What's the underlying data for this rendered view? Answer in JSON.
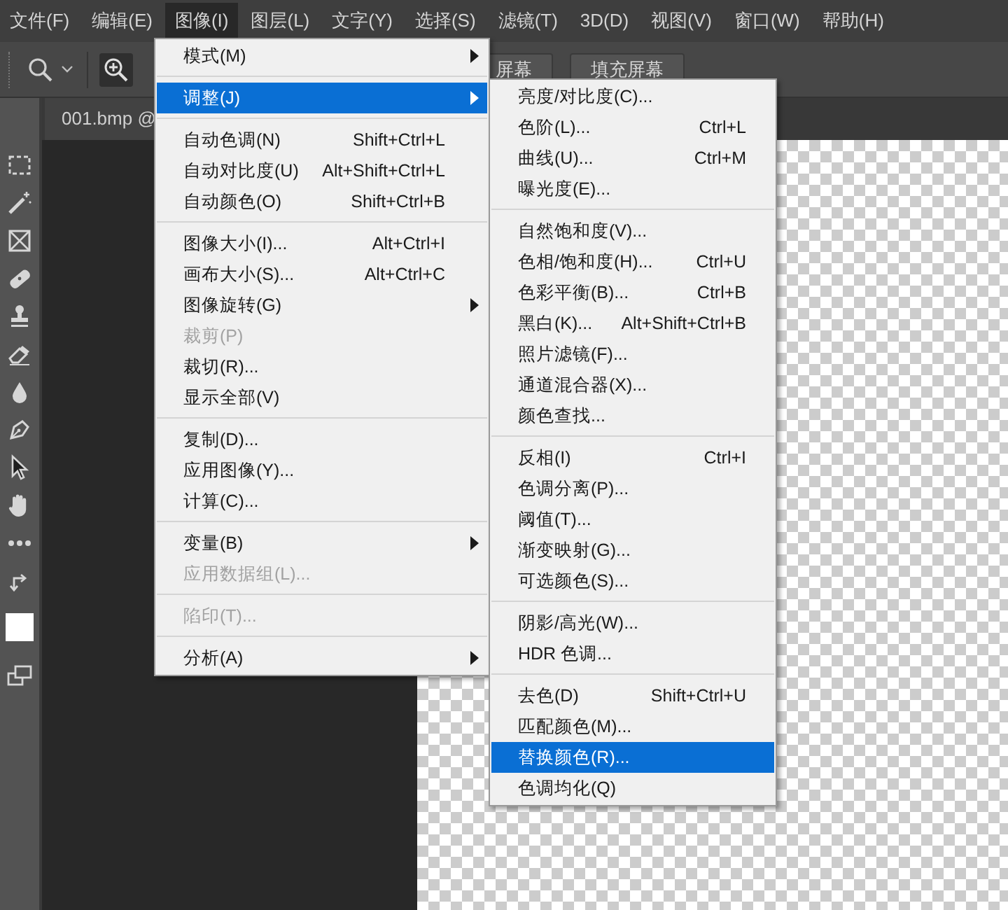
{
  "menu_bar": [
    {
      "label": "文件(F)",
      "selected": false
    },
    {
      "label": "编辑(E)",
      "selected": false
    },
    {
      "label": "图像(I)",
      "selected": true
    },
    {
      "label": "图层(L)",
      "selected": false
    },
    {
      "label": "文字(Y)",
      "selected": false
    },
    {
      "label": "选择(S)",
      "selected": false
    },
    {
      "label": "滤镜(T)",
      "selected": false
    },
    {
      "label": "3D(D)",
      "selected": false
    },
    {
      "label": "视图(V)",
      "selected": false
    },
    {
      "label": "窗口(W)",
      "selected": false
    },
    {
      "label": "帮助(H)",
      "selected": false
    }
  ],
  "options_bar": {
    "buttons": [
      "屏幕",
      "填充屏幕"
    ]
  },
  "document_tab": {
    "title": "001.bmp @"
  },
  "image_menu": {
    "groups": [
      [
        {
          "label": "模式(M)",
          "submenu": true,
          "disabled": false,
          "selected": false
        }
      ],
      [
        {
          "label": "调整(J)",
          "submenu": true,
          "disabled": false,
          "selected": true
        }
      ],
      [
        {
          "label": "自动色调(N)",
          "shortcut": "Shift+Ctrl+L",
          "submenu": false,
          "disabled": false,
          "selected": false
        },
        {
          "label": "自动对比度(U)",
          "shortcut": "Alt+Shift+Ctrl+L",
          "submenu": false,
          "disabled": false,
          "selected": false
        },
        {
          "label": "自动颜色(O)",
          "shortcut": "Shift+Ctrl+B",
          "submenu": false,
          "disabled": false,
          "selected": false
        }
      ],
      [
        {
          "label": "图像大小(I)...",
          "shortcut": "Alt+Ctrl+I",
          "submenu": false,
          "disabled": false,
          "selected": false
        },
        {
          "label": "画布大小(S)...",
          "shortcut": "Alt+Ctrl+C",
          "submenu": false,
          "disabled": false,
          "selected": false
        },
        {
          "label": "图像旋转(G)",
          "submenu": true,
          "disabled": false,
          "selected": false
        },
        {
          "label": "裁剪(P)",
          "submenu": false,
          "disabled": true,
          "selected": false
        },
        {
          "label": "裁切(R)...",
          "submenu": false,
          "disabled": false,
          "selected": false
        },
        {
          "label": "显示全部(V)",
          "submenu": false,
          "disabled": false,
          "selected": false
        }
      ],
      [
        {
          "label": "复制(D)...",
          "submenu": false,
          "disabled": false,
          "selected": false
        },
        {
          "label": "应用图像(Y)...",
          "submenu": false,
          "disabled": false,
          "selected": false
        },
        {
          "label": "计算(C)...",
          "submenu": false,
          "disabled": false,
          "selected": false
        }
      ],
      [
        {
          "label": "变量(B)",
          "submenu": true,
          "disabled": false,
          "selected": false
        },
        {
          "label": "应用数据组(L)...",
          "submenu": false,
          "disabled": true,
          "selected": false
        }
      ],
      [
        {
          "label": "陷印(T)...",
          "submenu": false,
          "disabled": true,
          "selected": false
        }
      ],
      [
        {
          "label": "分析(A)",
          "submenu": true,
          "disabled": false,
          "selected": false
        }
      ]
    ]
  },
  "adjustments_submenu": {
    "groups": [
      [
        {
          "label": "亮度/对比度(C)...",
          "disabled": false,
          "selected": false
        },
        {
          "label": "色阶(L)...",
          "shortcut": "Ctrl+L",
          "disabled": false,
          "selected": false
        },
        {
          "label": "曲线(U)...",
          "shortcut": "Ctrl+M",
          "disabled": false,
          "selected": false
        },
        {
          "label": "曝光度(E)...",
          "disabled": false,
          "selected": false
        }
      ],
      [
        {
          "label": "自然饱和度(V)...",
          "disabled": false,
          "selected": false
        },
        {
          "label": "色相/饱和度(H)...",
          "shortcut": "Ctrl+U",
          "disabled": false,
          "selected": false
        },
        {
          "label": "色彩平衡(B)...",
          "shortcut": "Ctrl+B",
          "disabled": false,
          "selected": false
        },
        {
          "label": "黑白(K)...",
          "shortcut": "Alt+Shift+Ctrl+B",
          "disabled": false,
          "selected": false
        },
        {
          "label": "照片滤镜(F)...",
          "disabled": false,
          "selected": false
        },
        {
          "label": "通道混合器(X)...",
          "disabled": false,
          "selected": false
        },
        {
          "label": "颜色查找...",
          "disabled": false,
          "selected": false
        }
      ],
      [
        {
          "label": "反相(I)",
          "shortcut": "Ctrl+I",
          "disabled": false,
          "selected": false
        },
        {
          "label": "色调分离(P)...",
          "disabled": false,
          "selected": false
        },
        {
          "label": "阈值(T)...",
          "disabled": false,
          "selected": false
        },
        {
          "label": "渐变映射(G)...",
          "disabled": false,
          "selected": false
        },
        {
          "label": "可选颜色(S)...",
          "disabled": false,
          "selected": false
        }
      ],
      [
        {
          "label": "阴影/高光(W)...",
          "disabled": false,
          "selected": false
        },
        {
          "label": "HDR 色调...",
          "disabled": false,
          "selected": false
        }
      ],
      [
        {
          "label": "去色(D)",
          "shortcut": "Shift+Ctrl+U",
          "disabled": false,
          "selected": false
        },
        {
          "label": "匹配颜色(M)...",
          "disabled": false,
          "selected": false
        },
        {
          "label": "替换颜色(R)...",
          "disabled": false,
          "selected": true
        },
        {
          "label": "色调均化(Q)",
          "disabled": false,
          "selected": false
        }
      ]
    ]
  }
}
